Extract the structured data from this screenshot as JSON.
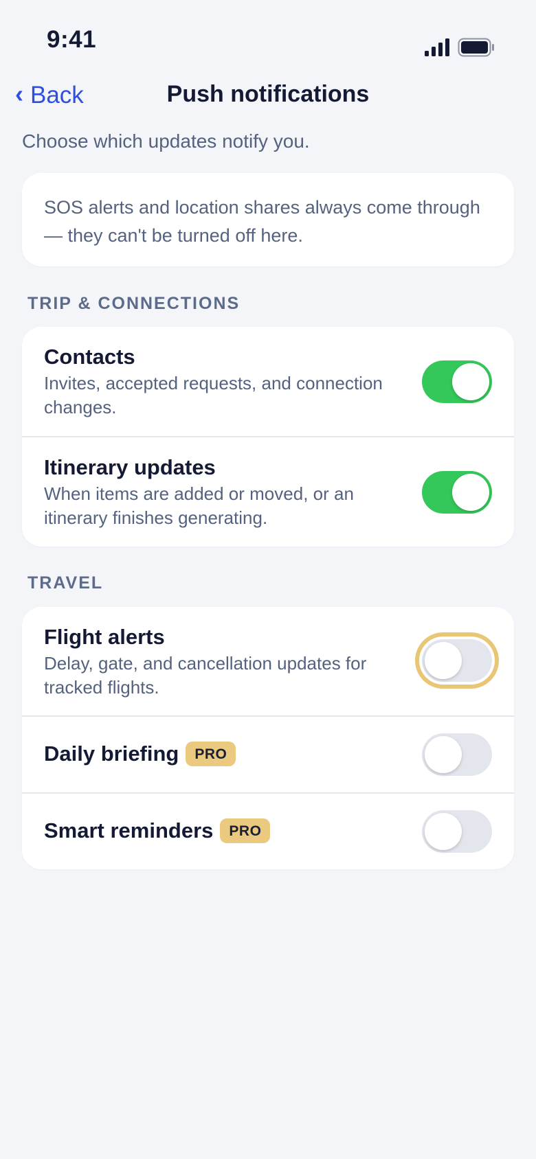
{
  "status": {
    "time": "9:41"
  },
  "nav": {
    "back_label": "Back",
    "title": "Push notifications"
  },
  "subtitle": "Choose which updates notify you.",
  "info": "SOS alerts and location shares always come through — they can't be turned off here.",
  "sections": [
    {
      "header": "TRIP & CONNECTIONS",
      "rows": [
        {
          "title": "Contacts",
          "description": "Invites, accepted requests, and connection changes.",
          "enabled": true
        },
        {
          "title": "Itinerary updates",
          "description": "When items are added or moved, or an itinerary finishes generating.",
          "enabled": true
        }
      ]
    },
    {
      "header": "TRAVEL",
      "rows": [
        {
          "title": "Flight alerts",
          "description": "Delay, gate, and cancellation updates for tracked flights.",
          "enabled": false,
          "focused": true
        },
        {
          "title": "Daily briefing",
          "badge": "PRO",
          "enabled": false
        },
        {
          "title": "Smart reminders",
          "badge": "PRO",
          "enabled": false
        }
      ]
    }
  ],
  "colors": {
    "accent": "#2f4fe0",
    "toggle_on": "#34c759",
    "toggle_off": "#e3e6ec",
    "pro_badge": "#ebca80",
    "focus_ring": "#e9c675"
  },
  "icons": {
    "signal": "cellular-signal-icon",
    "battery": "battery-icon",
    "back": "chevron-left-icon"
  }
}
